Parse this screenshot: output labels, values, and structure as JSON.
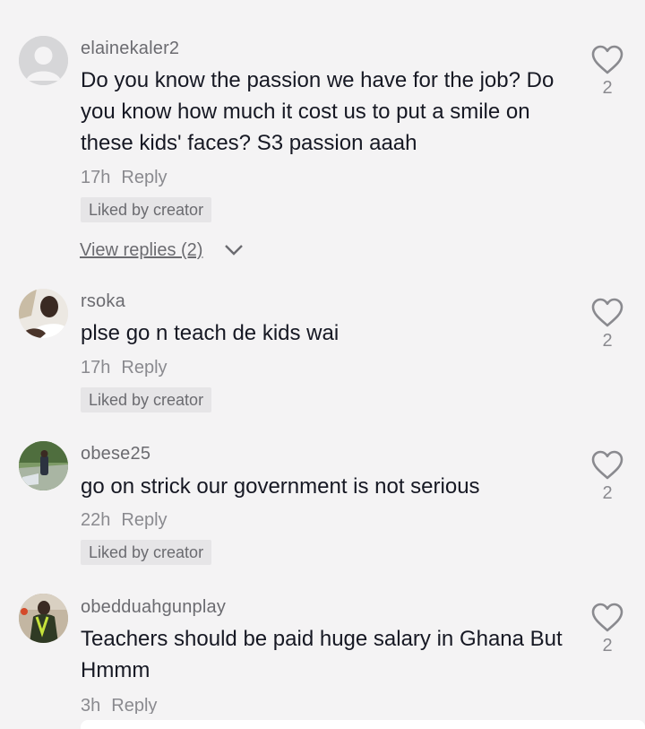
{
  "comments": [
    {
      "username": "elainekaler2",
      "text": "Do you know the passion we have for the job? Do you know how much it cost us to put a smile on these kids' faces? S3 passion aaah",
      "time": "17h",
      "reply_label": "Reply",
      "badge": "Liked by creator",
      "likes": "2",
      "view_replies": "View replies (2)",
      "avatar_icon": "default-avatar-icon"
    },
    {
      "username": "rsoka",
      "text": "plse go n teach de kids wai",
      "time": "17h",
      "reply_label": "Reply",
      "badge": "Liked by creator",
      "likes": "2"
    },
    {
      "username": "obese25",
      "text": "go on strick our government is not serious",
      "time": "22h",
      "reply_label": "Reply",
      "badge": "Liked by creator",
      "likes": "2"
    },
    {
      "username": "obedduahgunplay",
      "text": "Teachers should be paid huge salary in Ghana But Hmmm",
      "time": "3h",
      "reply_label": "Reply",
      "likes": "2"
    }
  ],
  "icons": {
    "like": "heart-outline-icon",
    "expand": "chevron-down-icon"
  },
  "colors": {
    "background": "#f4f3f4",
    "text": "#161823",
    "secondary": "#8a8a8f",
    "badge_bg": "#e6e5e7"
  }
}
